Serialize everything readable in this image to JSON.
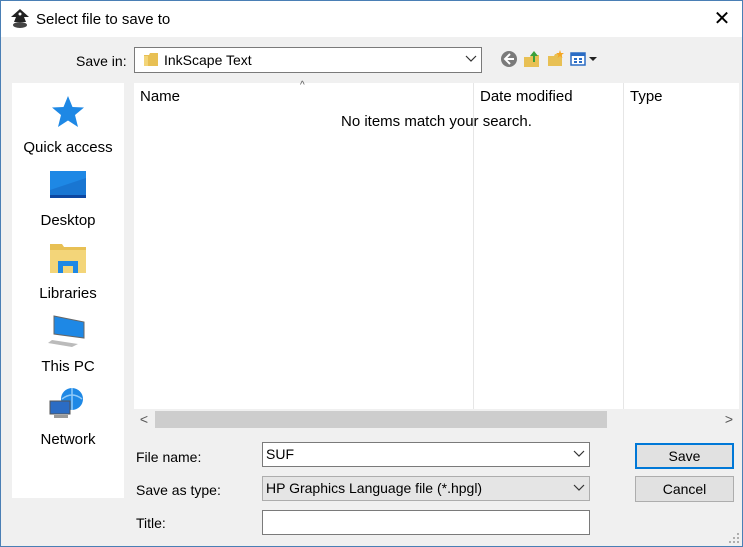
{
  "dialog": {
    "title": "Select file to save to",
    "close_glyph": "✕"
  },
  "save_in": {
    "label": "Save in:",
    "folder": "InkScape Text"
  },
  "toolbar": {
    "icons": [
      "back-icon",
      "up-folder-icon",
      "new-folder-icon",
      "view-menu-icon"
    ]
  },
  "places": [
    {
      "label": "Quick access",
      "icon": "star-icon"
    },
    {
      "label": "Desktop",
      "icon": "desktop-icon"
    },
    {
      "label": "Libraries",
      "icon": "libraries-icon"
    },
    {
      "label": "This PC",
      "icon": "computer-icon"
    },
    {
      "label": "Network",
      "icon": "network-icon"
    }
  ],
  "file_list": {
    "columns": [
      "Name",
      "Date modified",
      "Type"
    ],
    "empty_message": "No items match your search.",
    "sort_glyph": "^"
  },
  "scrollbar": {
    "left_glyph": "<",
    "right_glyph": ">"
  },
  "form": {
    "file_name_label": "File name:",
    "file_name_value": "SUF",
    "save_type_label": "Save as type:",
    "save_type_value": "HP Graphics Language file (*.hpgl)",
    "title_label": "Title:",
    "title_value": ""
  },
  "buttons": {
    "save": "Save",
    "cancel": "Cancel"
  },
  "colors": {
    "accent": "#0078d7",
    "window_border": "#4a7fb5"
  }
}
